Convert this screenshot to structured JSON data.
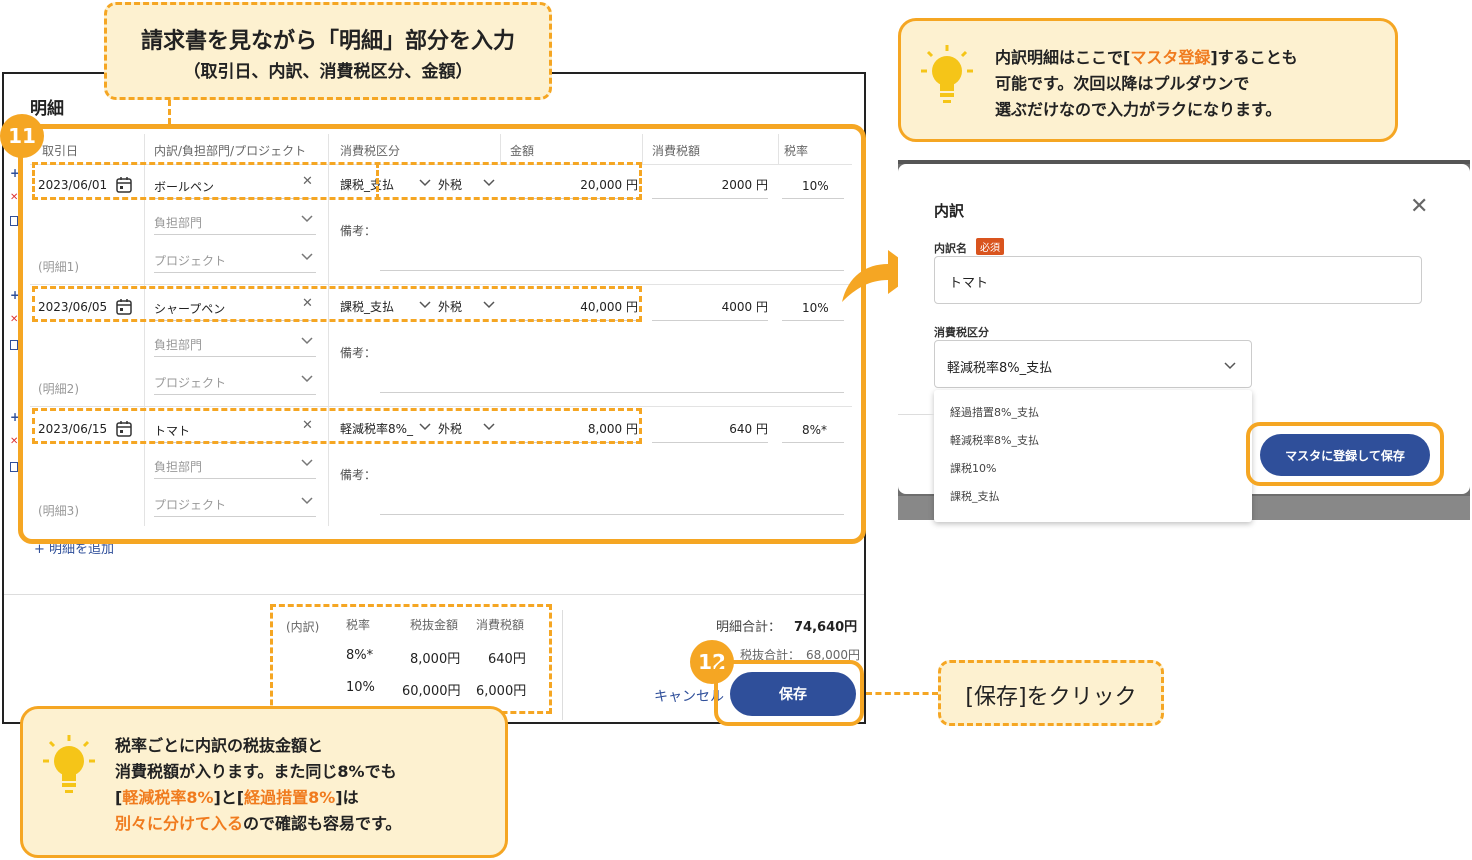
{
  "top_callout": {
    "line1": "請求書を見ながら「明細」部分を入力",
    "line2": "（取引日、内訳、消費税区分、金額）"
  },
  "panel": {
    "title": "明細",
    "columns": [
      "取引日",
      "内訳/負担部門/プロジェクト",
      "消費税区分",
      "金額",
      "消費税額",
      "税率"
    ],
    "rows": [
      {
        "date": "2023/06/01",
        "item": "ボールペン",
        "tax_class": "課税_支払",
        "tax_type": "外税",
        "amount": "20,000 円",
        "tax": "2000 円",
        "rate": "10%",
        "dept": "負担部門",
        "project": "プロジェクト",
        "memo": "備考：",
        "label": "(明細1)"
      },
      {
        "date": "2023/06/05",
        "item": "シャープペン",
        "tax_class": "課税_支払",
        "tax_type": "外税",
        "amount": "40,000 円",
        "tax": "4000 円",
        "rate": "10%",
        "dept": "負担部門",
        "project": "プロジェクト",
        "memo": "備考：",
        "label": "(明細2)"
      },
      {
        "date": "2023/06/15",
        "item": "トマト",
        "tax_class": "軽減税率8%_",
        "tax_type": "外税",
        "amount": "8,000 円",
        "tax": "640 円",
        "rate": "8%*",
        "dept": "負担部門",
        "project": "プロジェクト",
        "memo": "備考：",
        "label": "(明細3)"
      }
    ],
    "add_link": "+ 明細を追加",
    "summary": {
      "breakdown_label": "(内訳)",
      "headers": [
        "税率",
        "税抜金額",
        "消費税額"
      ],
      "rows": [
        {
          "rate": "8%*",
          "net": "8,000円",
          "tax": "640円"
        },
        {
          "rate": "10%",
          "net": "60,000円",
          "tax": "6,000円"
        }
      ],
      "total_label": "明細合計：",
      "total_value": "74,640円",
      "net_total_label": "税抜合計：",
      "net_total_value": "68,000円"
    },
    "cancel_label": "キャンセル",
    "save_label": "保存"
  },
  "badges": {
    "step11": "11",
    "step12": "12"
  },
  "right_callout": {
    "t1": "内訳明細はここで[",
    "t2": "マスタ登録",
    "t3": "]することも",
    "line2": "可能です。次回以降はプルダウンで",
    "line3": "選ぶだけなので入力がラクになります。"
  },
  "modal": {
    "title": "内訳",
    "name_label": "内訳名",
    "required_badge": "必須",
    "name_value": "トマト",
    "tax_label": "消費税区分",
    "tax_value": "軽減税率8%_支払",
    "options": [
      "経過措置8%_支払",
      "軽減税率8%_支払",
      "課税10%",
      "課税_支払"
    ],
    "register_button": "マスタに登録して保存"
  },
  "save_callout": "[保存]をクリック",
  "bottom_callout": {
    "line1": "税率ごとに内訳の税抜金額と",
    "line2": "消費税額が入ります。また同じ8%でも",
    "l3a": "[",
    "l3b": "軽減税率8%",
    "l3c": "]と[",
    "l3d": "経過措置8%",
    "l3e": "]は",
    "l4a": "別々に分けて入る",
    "l4b": "ので確認も容易です。"
  },
  "colors": {
    "accent": "#f5a623",
    "highlight": "#f07b1e",
    "primary_button": "#2f4f9a",
    "callout_bg": "#fdf1d0"
  }
}
